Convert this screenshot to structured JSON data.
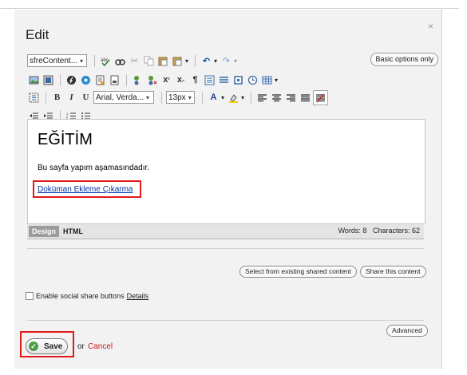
{
  "dialog": {
    "title": "Edit",
    "close_glyph": "×"
  },
  "toolbar": {
    "format_select": "sfreContent...",
    "font_select": "Arial, Verda...",
    "size_select": "13px",
    "basic_options_label": "Basic options only",
    "row1_icons": [
      "spellcheck-icon",
      "find-icon",
      "cut-icon",
      "copy-icon",
      "paste-icon",
      "paste-special-icon",
      "undo-icon",
      "redo-icon"
    ],
    "row2_icons": [
      "image-icon",
      "gallery-icon",
      "flash-icon",
      "media-icon",
      "document-icon",
      "template-icon",
      "link-icon",
      "unlink-icon",
      "superscript-icon",
      "subscript-icon",
      "paragraph-icon",
      "align-left-block-icon",
      "align-center-block-icon",
      "anchor-icon",
      "clock-icon",
      "table-icon"
    ],
    "row3_icons": [
      "select-all-icon",
      "bold-icon",
      "italic-icon",
      "underline-icon",
      "font-color-icon",
      "highlight-icon",
      "justify-left-icon",
      "justify-center-icon",
      "justify-right-icon",
      "justify-full-icon",
      "clear-format-icon"
    ],
    "row4_icons": [
      "outdent-icon",
      "indent-icon",
      "ordered-list-icon",
      "unordered-list-icon"
    ]
  },
  "editor": {
    "heading": "EĞİTİM",
    "paragraph": "Bu sayfa yapım aşamasındadır.",
    "link_text": "Doküman Ekleme Çıkarma"
  },
  "modebar": {
    "design_tab": "Design",
    "html_tab": "HTML",
    "word_count": "Words: 8",
    "char_count": "Characters: 62"
  },
  "shared": {
    "select_existing_label": "Select from existing shared content",
    "share_this_label": "Share this content"
  },
  "social": {
    "checkbox_label": "Enable social share buttons",
    "details_link": "Details"
  },
  "footer": {
    "advanced_label": "Advanced",
    "save_label": "Save",
    "or_text": "or",
    "cancel_label": "Cancel"
  },
  "colors": {
    "highlight_box": "#e01a1a",
    "link": "#0033aa",
    "cancel": "#cc1a1a",
    "save_check": "#4aa04a"
  }
}
